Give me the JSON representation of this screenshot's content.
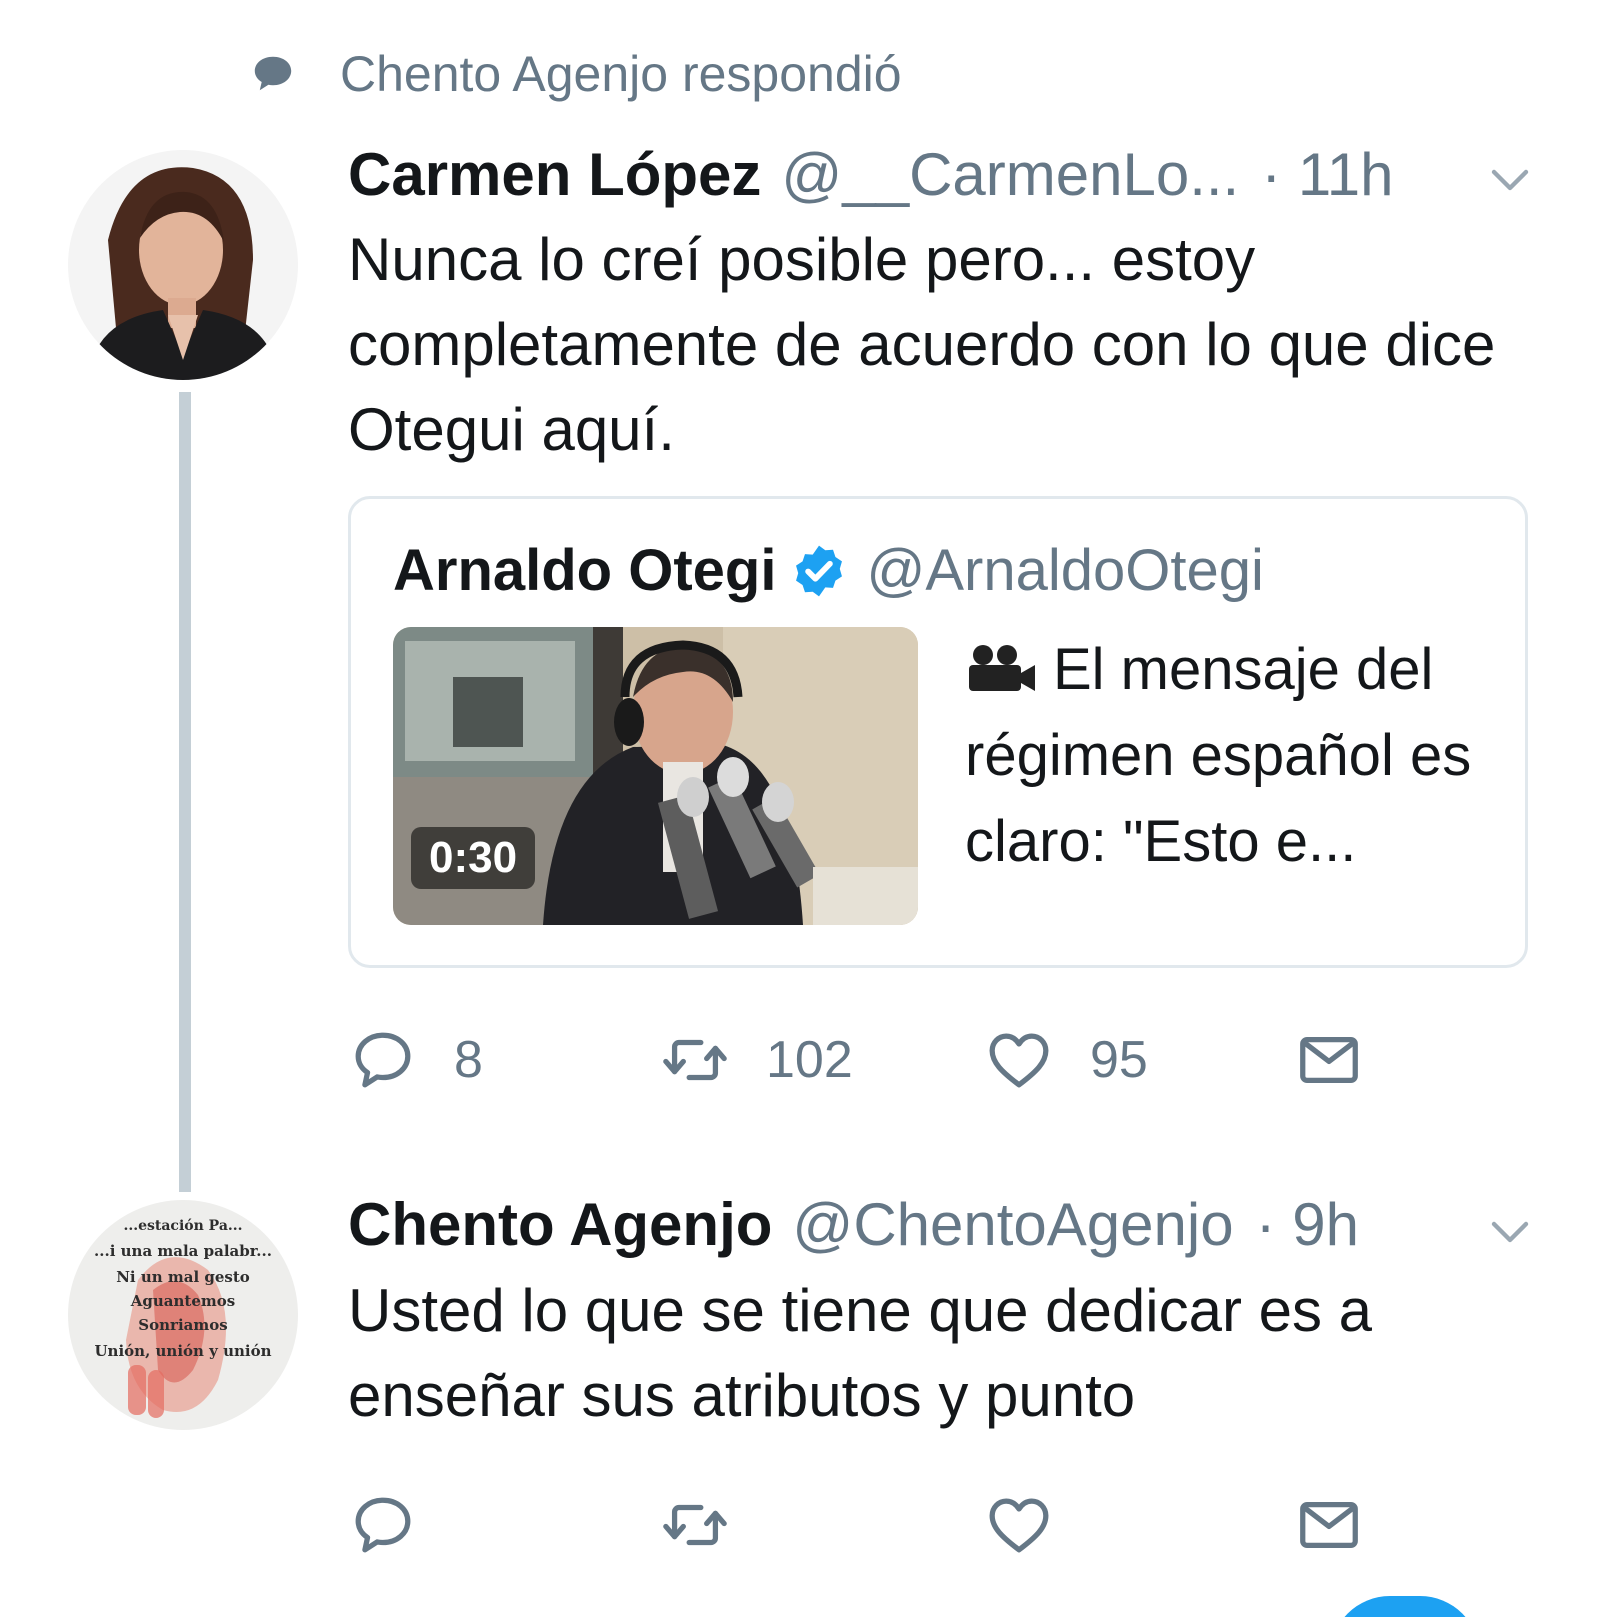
{
  "context": {
    "text": "Chento Agenjo respondió",
    "icon": "speech-bubble-icon"
  },
  "tweet1": {
    "name": "Carmen López",
    "handle": "@__CarmenLo...",
    "time": "· 11h",
    "text": "Nunca lo creí posible pero... estoy completamente de acuerdo con lo que dice Otegui aquí.",
    "quote": {
      "name": "Arnaldo Otegi",
      "handle": "@ArnaldoOtegi",
      "verified": true,
      "video_duration": "0:30",
      "text": "El mensaje del régimen español es claro: \"Esto e..."
    },
    "actions": {
      "replies": "8",
      "retweets": "102",
      "likes": "95"
    }
  },
  "tweet2": {
    "name": "Chento Agenjo",
    "handle": "@ChentoAgenjo",
    "time": "· 9h",
    "text": "Usted lo que se tiene que dedicar es a enseñar sus atributos y punto",
    "avatar_text": [
      "...estación Pa...",
      "...i una mala palabr...",
      "Ni un mal gesto",
      "Aguantemos",
      "Sonriamos",
      "Unión, unión y unión"
    ]
  },
  "colors": {
    "secondary_text": "#657786",
    "primary_text": "#14171a",
    "accent": "#1da1f2",
    "thread_line": "#c4cfd6",
    "border": "#e1e8ed"
  }
}
